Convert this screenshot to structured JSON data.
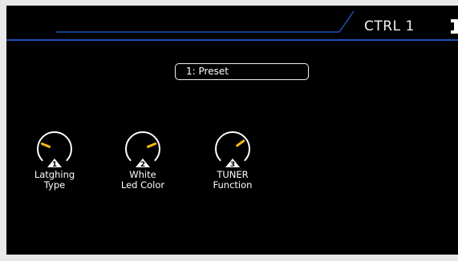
{
  "header": {
    "title": "CTRL 1"
  },
  "preset": {
    "label": "1: Preset"
  },
  "knobs": [
    {
      "index": "1",
      "line1": "Latghing",
      "line2": "Type",
      "level": 0.25
    },
    {
      "index": "2",
      "line1": "White",
      "line2": "Led Color",
      "level": 0.75
    },
    {
      "index": "3",
      "line1": "TUNER",
      "line2": "Function",
      "level": 0.7
    }
  ],
  "colors": {
    "background": "#000000",
    "accent_line": "#1f4fb8",
    "knob_indicator": "#f2b90f",
    "frame": "#e8e8e8"
  }
}
